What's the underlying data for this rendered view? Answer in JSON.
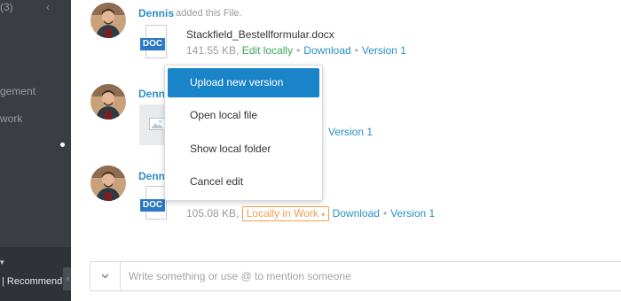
{
  "sidebar": {
    "count_label": "(3)",
    "collapse_chevron": "‹",
    "items": [
      {
        "label": "gement"
      },
      {
        "label": "work"
      }
    ],
    "bottom_caret": "▾",
    "recommend_label": "| Recommend",
    "toggle_chevron": "‹"
  },
  "feed": {
    "posts": [
      {
        "author": "Dennis",
        "action": "added this File.",
        "file": {
          "type_label": "DOC",
          "name": "Stackfield_Bestellformular.docx",
          "size": "141.55 KB,",
          "status": "Edit locally",
          "download": "Download",
          "version": "Version 1"
        }
      },
      {
        "author": "Denn",
        "file": {
          "version": "Version 1"
        }
      },
      {
        "author": "Denn",
        "file": {
          "type_label": "DOC",
          "size": "105.08 KB,",
          "status": "Locally in Work",
          "status_caret": "▾",
          "download": "Download",
          "version": "Version 1"
        }
      }
    ]
  },
  "context_menu": {
    "items": [
      {
        "label": "Upload new version",
        "active": true
      },
      {
        "label": "Open local file",
        "active": false
      },
      {
        "label": "Show local folder",
        "active": false
      },
      {
        "label": "Cancel edit",
        "active": false
      }
    ]
  },
  "comment": {
    "placeholder": "Write something or use @ to mention someone"
  },
  "colors": {
    "accent_blue": "#2a8fc7",
    "menu_active": "#1a84c8",
    "green_status": "#3aa657",
    "orange_status": "#f0a04b",
    "sidebar_bg": "#3a3d42",
    "doc_badge": "#2c78c4"
  },
  "icons": {
    "avatar": "user-photo",
    "doc_file": "doc-file-icon",
    "image_placeholder": "image-icon",
    "comment_toggle": "chevron-down-icon"
  }
}
